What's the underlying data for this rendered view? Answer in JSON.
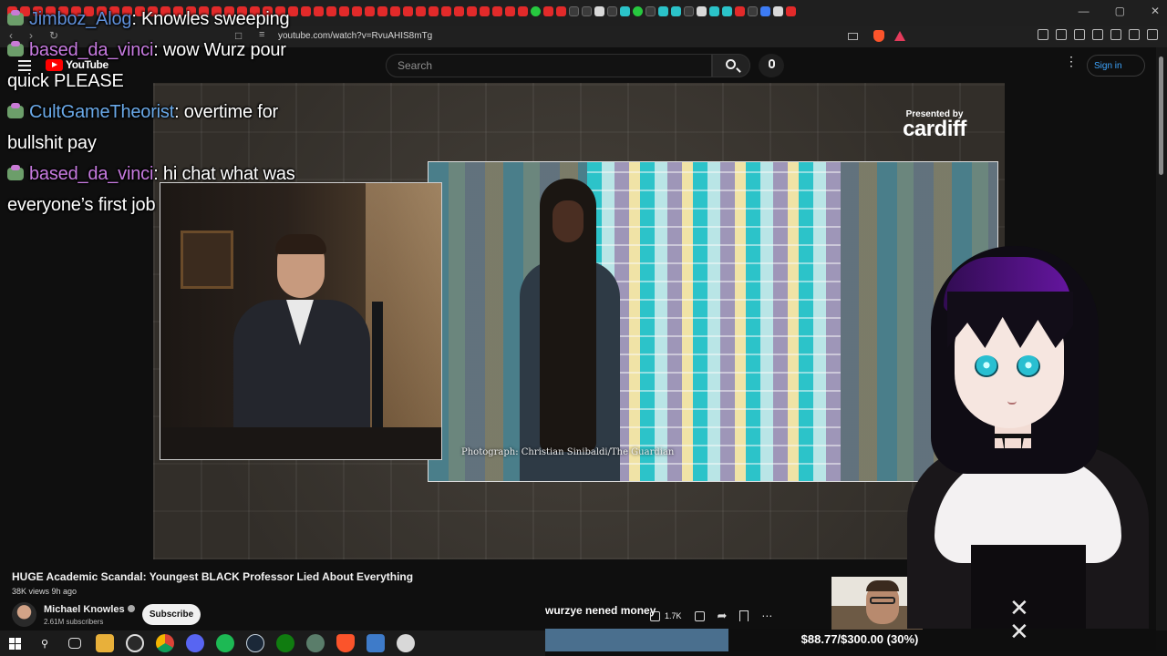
{
  "browser": {
    "url": "youtube.com/watch?v=RvuAHIS8mTg",
    "window_controls": [
      "—",
      "▢",
      "✕"
    ]
  },
  "youtube": {
    "logo_text": "YouTube",
    "search_placeholder": "Search",
    "sign_in_label": "Sign in"
  },
  "chat": [
    {
      "user": "Jimboz_Alog",
      "user_color": "#5f8fd8",
      "text": ": Knowles sweeping"
    },
    {
      "user": "based_da_vinci",
      "user_color": "#c77be0",
      "text": ": wow Wurz pour quick PLEASE"
    },
    {
      "user": "CultGameTheorist",
      "user_color": "#6aa9e8",
      "text": ": overtime for bullshit pay"
    },
    {
      "user": "based_da_vinci",
      "user_color": "#c77be0",
      "text": ": hi chat what was everyone’s first job"
    }
  ],
  "video": {
    "sponsor_prefix": "Presented by",
    "sponsor_brand": "cardiff",
    "photo_caption": "Photograph: Christian Sinibaldi/The Guardian"
  },
  "details": {
    "title": "HUGE Academic Scandal: Youngest BLACK Professor Lied About Everything",
    "meta": "38K views  9h ago",
    "channel_name": "Michael Knowles",
    "subscribers": "2.61M subscribers",
    "subscribe_label": "Subscribe",
    "like_count": "1.7K"
  },
  "stream_goal": {
    "label": "wurzye nened money",
    "amount_text": "$88.77/$300.00 (30%)",
    "progress": 0.3,
    "fill_color": "#4a6f8e"
  },
  "taskbar_icons": [
    "windows-start-icon",
    "search-icon",
    "task-view-icon",
    "file-explorer-icon",
    "obs-icon",
    "chrome-icon",
    "discord-icon",
    "spotify-icon",
    "steam-icon",
    "xbox-icon",
    "app-icon",
    "brave-icon",
    "vscode-icon",
    "app-icon-2"
  ]
}
